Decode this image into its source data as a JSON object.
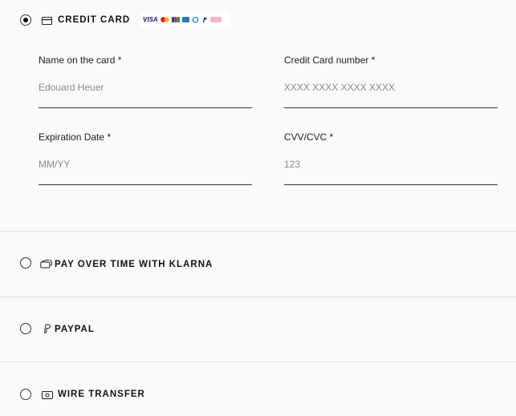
{
  "credit_card": {
    "label": "CREDIT CARD",
    "selected": true,
    "brands": [
      "VISA",
      "mastercard",
      "JCB",
      "amex",
      "diners",
      "paypal",
      "klarna"
    ],
    "fields": {
      "name": {
        "label": "Name on the card *",
        "value": "",
        "placeholder": "Edouard Heuer"
      },
      "number": {
        "label": "Credit Card number *",
        "value": "",
        "placeholder": "XXXX XXXX XXXX XXXX"
      },
      "expiry": {
        "label": "Expiration Date *",
        "value": "",
        "placeholder": "MM/YY"
      },
      "cvv": {
        "label": "CVV/CVC *",
        "value": "",
        "placeholder": "123"
      }
    }
  },
  "klarna": {
    "label": "PAY OVER TIME WITH KLARNA",
    "selected": false
  },
  "paypal": {
    "label": "PAYPAL",
    "selected": false
  },
  "wire": {
    "label": "WIRE TRANSFER",
    "selected": false
  },
  "colors": {
    "background": "#fafafa",
    "text": "#111111",
    "divider": "#e4e4e4",
    "klarna_pink": "#f5b6c8"
  }
}
